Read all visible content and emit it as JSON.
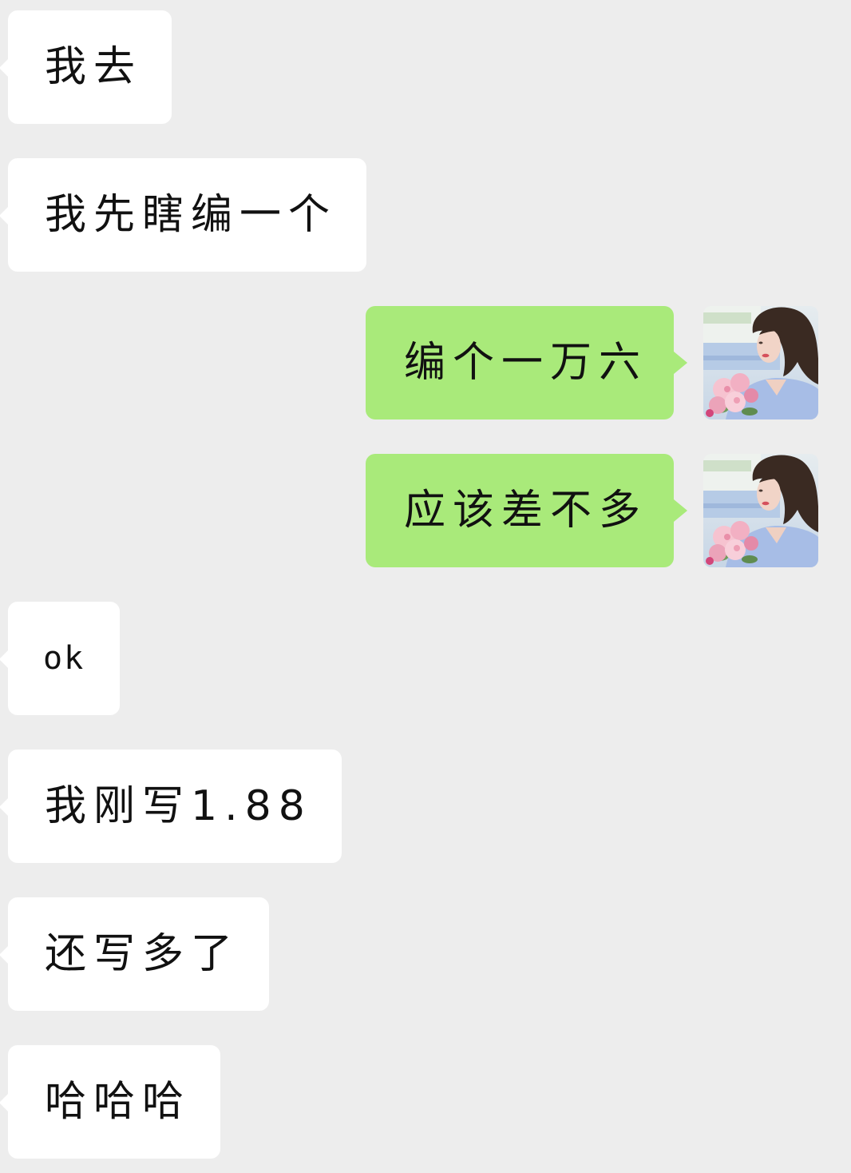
{
  "colors": {
    "background": "#ededed",
    "incoming_bubble": "#ffffff",
    "outgoing_bubble": "#a9ea7a",
    "text": "#111111"
  },
  "messages": [
    {
      "text": "我去"
    },
    {
      "text": "我先瞎编一个"
    },
    {
      "text": "编个一万六",
      "avatar_icon": "user-photo-avatar-icon"
    },
    {
      "text": "应该差不多",
      "avatar_icon": "user-photo-avatar-icon"
    },
    {
      "text": "ok"
    },
    {
      "text": "我刚写1.88"
    },
    {
      "text": "还写多了"
    },
    {
      "text": "哈哈哈"
    }
  ]
}
